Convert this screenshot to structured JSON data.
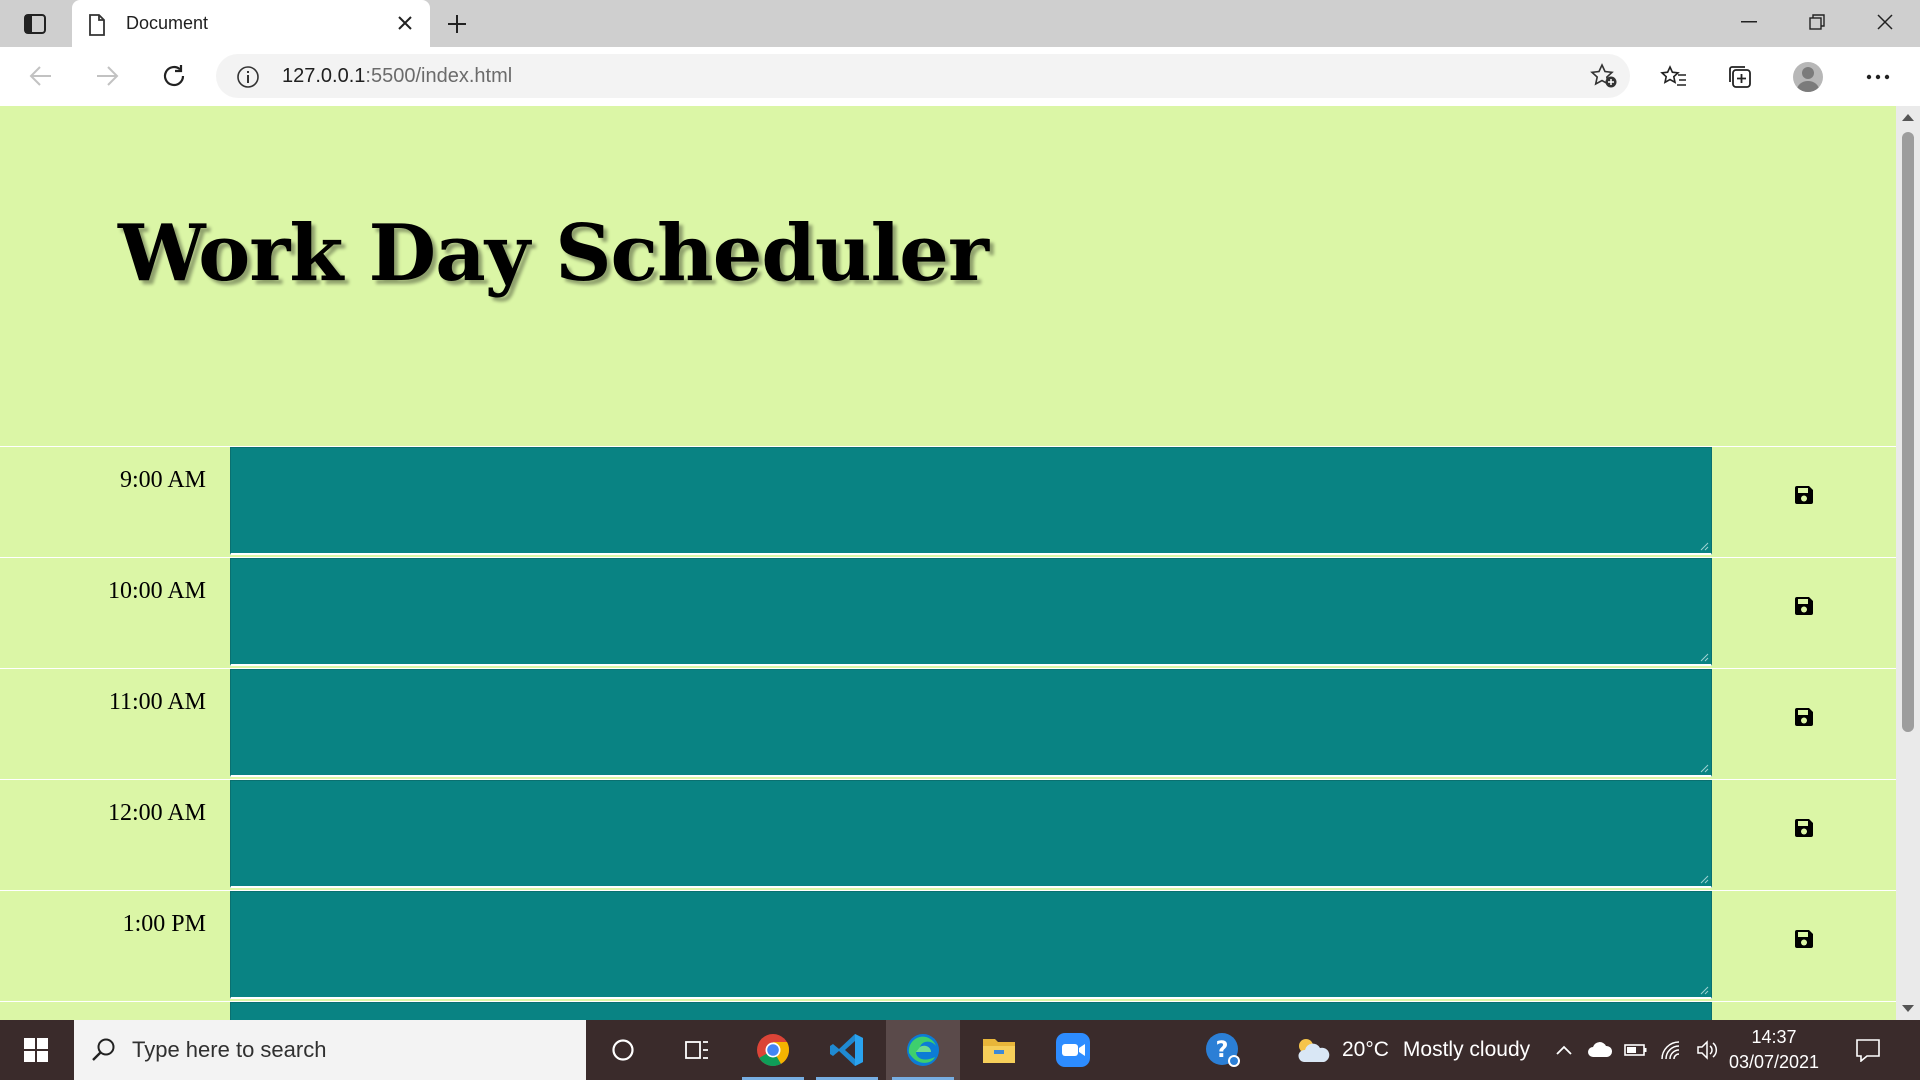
{
  "browser": {
    "tab_title": "Document",
    "url_host": "127.0.0.1",
    "url_rest": ":5500/index.html"
  },
  "page": {
    "title": "Work Day Scheduler",
    "save_icon": "floppy-disk-icon",
    "rows": [
      {
        "hour": "9:00 AM"
      },
      {
        "hour": "10:00 AM"
      },
      {
        "hour": "11:00 AM"
      },
      {
        "hour": "12:00 AM"
      },
      {
        "hour": "1:00 PM"
      },
      {
        "hour": ""
      }
    ],
    "colors": {
      "background": "#dbf6a6",
      "textarea": "#098383"
    }
  },
  "taskbar": {
    "search_placeholder": "Type here to search",
    "weather_temp": "20°C",
    "weather_condition": "Mostly cloudy",
    "time": "14:37",
    "date": "03/07/2021"
  }
}
